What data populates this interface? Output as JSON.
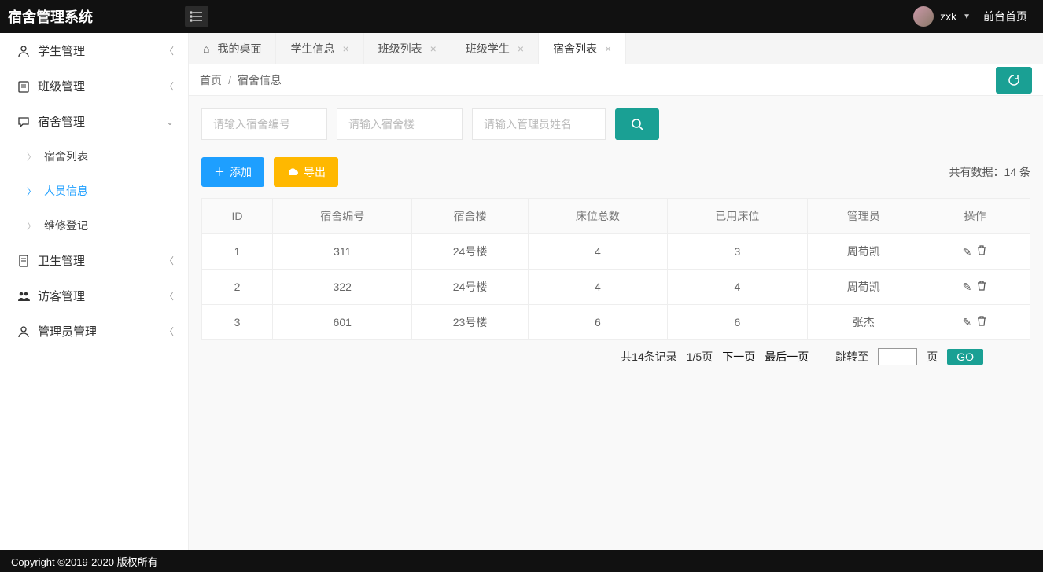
{
  "app_title": "宿舍管理系统",
  "user_name": "zxk",
  "front_link": "前台首页",
  "sidebar": {
    "items": [
      {
        "label": "学生管理",
        "icon": "user"
      },
      {
        "label": "班级管理",
        "icon": "clipboard"
      },
      {
        "label": "宿舍管理",
        "icon": "chat",
        "expanded": true
      },
      {
        "label": "卫生管理",
        "icon": "doc"
      },
      {
        "label": "访客管理",
        "icon": "people"
      },
      {
        "label": "管理员管理",
        "icon": "user"
      }
    ],
    "subs": [
      {
        "label": "宿舍列表"
      },
      {
        "label": "人员信息",
        "active": true
      },
      {
        "label": "维修登记"
      }
    ]
  },
  "tabs": [
    {
      "label": "我的桌面",
      "home": true
    },
    {
      "label": "学生信息",
      "closable": true
    },
    {
      "label": "班级列表",
      "closable": true
    },
    {
      "label": "班级学生",
      "closable": true
    },
    {
      "label": "宿舍列表",
      "closable": true,
      "active": true
    }
  ],
  "breadcrumb": {
    "home": "首页",
    "sep": "/",
    "current": "宿舍信息"
  },
  "filters": {
    "dorm_code_ph": "请输入宿舍编号",
    "building_ph": "请输入宿舍楼",
    "manager_ph": "请输入管理员姓名"
  },
  "toolbar": {
    "add_label": "添加",
    "export_label": "导出",
    "count_prefix": "共有数据：",
    "count_value": "14",
    "count_suffix": " 条"
  },
  "table": {
    "headers": [
      "ID",
      "宿舍编号",
      "宿舍楼",
      "床位总数",
      "已用床位",
      "管理员",
      "操作"
    ],
    "rows": [
      {
        "id": "1",
        "code": "311",
        "building": "24号楼",
        "total": "4",
        "used": "3",
        "manager": "周荀凯"
      },
      {
        "id": "2",
        "code": "322",
        "building": "24号楼",
        "total": "4",
        "used": "4",
        "manager": "周荀凯"
      },
      {
        "id": "3",
        "code": "601",
        "building": "23号楼",
        "total": "6",
        "used": "6",
        "manager": "张杰"
      }
    ]
  },
  "pager": {
    "summary": "共14条记录",
    "page_info": "1/5页",
    "next": "下一页",
    "last": "最后一页",
    "jump_prefix": "跳转至",
    "jump_suffix": "页",
    "go": "GO"
  },
  "footer": "Copyright ©2019-2020 版权所有"
}
